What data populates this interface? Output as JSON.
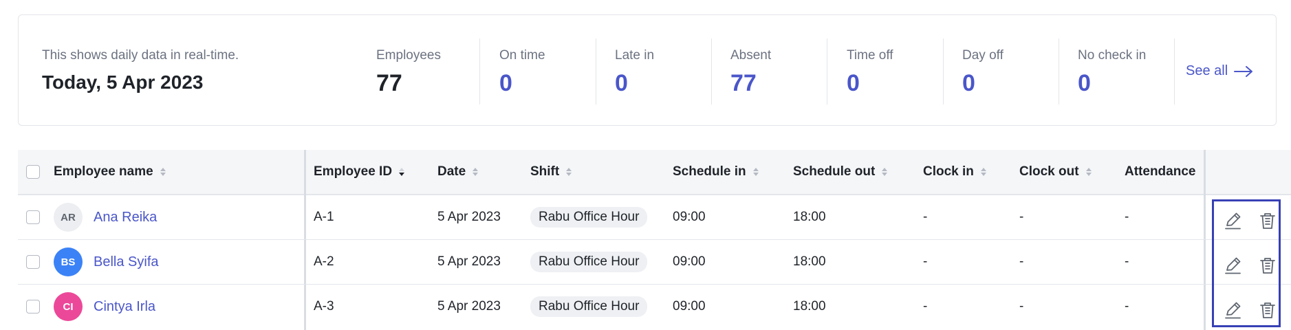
{
  "summary": {
    "subtitle": "This shows daily data in real-time.",
    "date": "Today, 5 Apr 2023",
    "stats": [
      {
        "label": "Employees",
        "value": "77"
      },
      {
        "label": "On time",
        "value": "0"
      },
      {
        "label": "Late in",
        "value": "0"
      },
      {
        "label": "Absent",
        "value": "77"
      },
      {
        "label": "Time off",
        "value": "0"
      },
      {
        "label": "Day off",
        "value": "0"
      },
      {
        "label": "No check in",
        "value": "0"
      }
    ],
    "see_all": "See all"
  },
  "table": {
    "columns": [
      "Employee name",
      "Employee ID",
      "Date",
      "Shift",
      "Schedule in",
      "Schedule out",
      "Clock in",
      "Clock out",
      "Attendance"
    ],
    "rows": [
      {
        "initials": "AR",
        "name": "Ana Reika",
        "id": "A-1",
        "date": "5 Apr 2023",
        "shift": "Rabu Office Hour",
        "schedule_in": "09:00",
        "schedule_out": "18:00",
        "clock_in": "-",
        "clock_out": "-",
        "attendance": "-",
        "avatar_color": "#eceef1",
        "avatar_text_color": "#5f6670"
      },
      {
        "initials": "BS",
        "name": "Bella Syifa",
        "id": "A-2",
        "date": "5 Apr 2023",
        "shift": "Rabu Office Hour",
        "schedule_in": "09:00",
        "schedule_out": "18:00",
        "clock_in": "-",
        "clock_out": "-",
        "attendance": "-",
        "avatar_color": "#3b82f6",
        "avatar_text_color": "#ffffff"
      },
      {
        "initials": "CI",
        "name": "Cintya Irla",
        "id": "A-3",
        "date": "5 Apr 2023",
        "shift": "Rabu Office Hour",
        "schedule_in": "09:00",
        "schedule_out": "18:00",
        "clock_in": "-",
        "clock_out": "-",
        "attendance": "-",
        "avatar_color": "#ec4899",
        "avatar_text_color": "#ffffff"
      }
    ]
  },
  "icons": {
    "edit": "pencil-icon",
    "delete": "trash-icon",
    "see_all": "arrow-right-icon"
  },
  "colors": {
    "accent": "#4a56c9",
    "highlight_box": "#3740b5"
  }
}
